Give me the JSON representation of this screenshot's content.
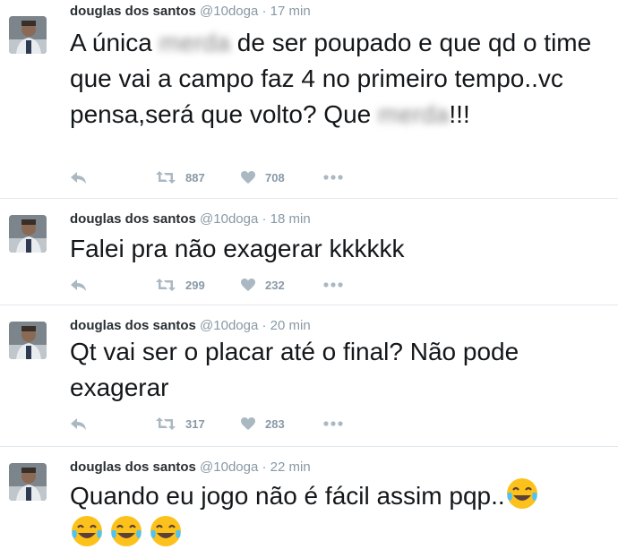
{
  "colors": {
    "icon": "#aab8c2",
    "text": "#14171a",
    "meta": "#8899a6",
    "divider": "#e1e8ed"
  },
  "tweets": [
    {
      "author": "douglas dos santos",
      "handle": "@10doga",
      "separator": "·",
      "time": "17 min",
      "text_parts": [
        "A única ",
        "merda",
        " de ser poupado e que qd o time que vai a campo faz 4 no primeiro tempo..vc pensa,será que volto? Que ",
        "merda",
        "!!!"
      ],
      "retweets": "887",
      "likes": "708"
    },
    {
      "author": "douglas dos santos",
      "handle": "@10doga",
      "separator": "·",
      "time": "18 min",
      "text": "Falei pra não exagerar kkkkkk",
      "retweets": "299",
      "likes": "232"
    },
    {
      "author": "douglas dos santos",
      "handle": "@10doga",
      "separator": "·",
      "time": "20 min",
      "text": "Qt vai ser o placar até o final? Não pode exagerar",
      "retweets": "317",
      "likes": "283"
    },
    {
      "author": "douglas dos santos",
      "handle": "@10doga",
      "separator": "·",
      "time": "22 min",
      "text": "Quando eu jogo não é fácil assim pqp..",
      "emoji": "face-with-tears-of-joy-icon"
    }
  ]
}
